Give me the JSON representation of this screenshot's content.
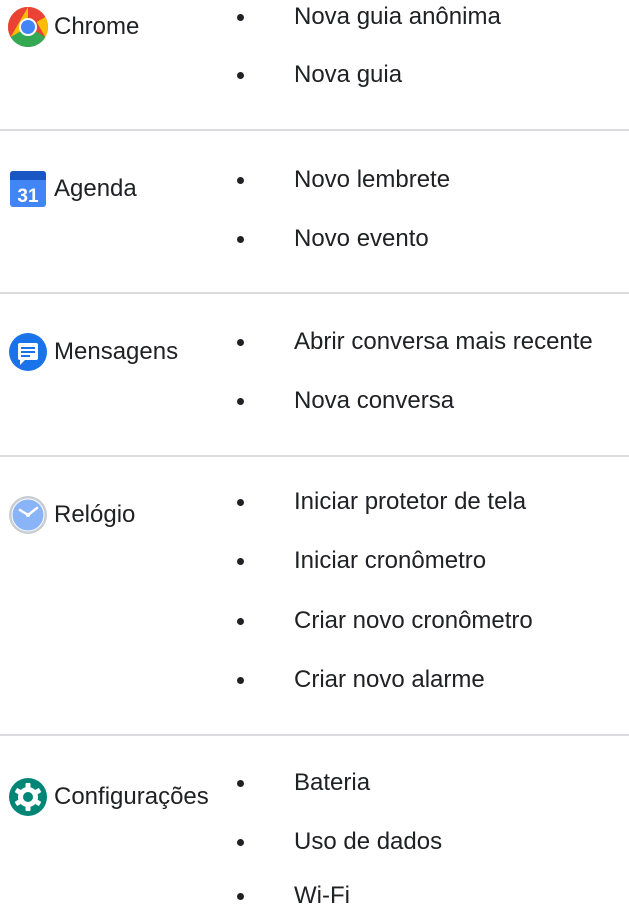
{
  "sections": [
    {
      "app": {
        "name": "Chrome",
        "icon": "chrome-icon"
      },
      "shortcuts": [
        "Nova guia anônima",
        "Nova guia"
      ]
    },
    {
      "app": {
        "name": "Agenda",
        "icon": "calendar-icon",
        "icon_text": "31"
      },
      "shortcuts": [
        "Novo lembrete",
        "Novo evento"
      ]
    },
    {
      "app": {
        "name": "Mensagens",
        "icon": "messages-icon"
      },
      "shortcuts": [
        "Abrir conversa mais recente",
        "Nova conversa"
      ]
    },
    {
      "app": {
        "name": "Relógio",
        "icon": "clock-icon"
      },
      "shortcuts": [
        "Iniciar protetor de tela",
        "Iniciar cronômetro",
        "Criar novo cronômetro",
        "Criar novo alarme"
      ]
    },
    {
      "app": {
        "name": "Configurações",
        "icon": "settings-gear-icon"
      },
      "shortcuts": [
        "Bateria",
        "Uso de dados",
        "Wi-Fi"
      ]
    }
  ],
  "colors": {
    "text": "#202124",
    "divider": "#dadce0",
    "chrome_red": "#ea4335",
    "chrome_yellow": "#fbbc04",
    "chrome_green": "#34a853",
    "chrome_blue": "#4285f4",
    "calendar_blue": "#4285f4",
    "messages_blue": "#1a73e8",
    "clock_blue": "#8ab4f8",
    "settings_teal": "#008577"
  }
}
